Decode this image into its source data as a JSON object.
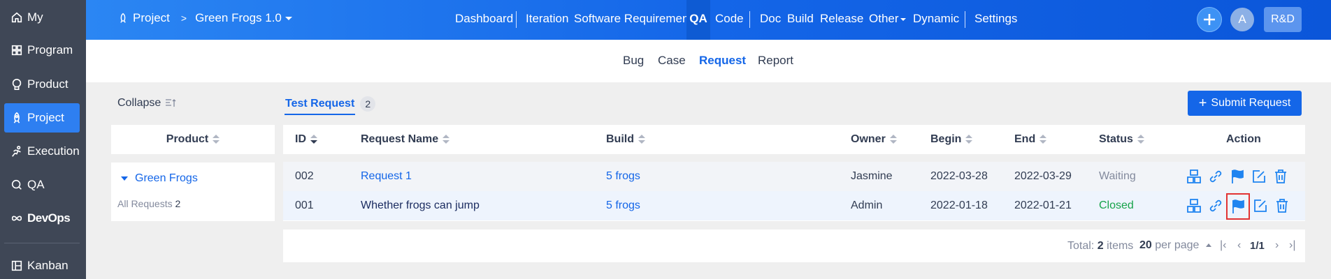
{
  "sidebar": {
    "items": [
      {
        "label": "My",
        "icon": "home-icon"
      },
      {
        "label": "Program",
        "icon": "grid-icon"
      },
      {
        "label": "Product",
        "icon": "lightbulb-icon"
      },
      {
        "label": "Project",
        "icon": "rocket-icon",
        "active": true
      },
      {
        "label": "Execution",
        "icon": "running-icon"
      },
      {
        "label": "QA",
        "icon": "magnifier-icon"
      },
      {
        "label": "DevOps",
        "icon": "infinity-icon"
      },
      {
        "label": "Kanban",
        "icon": "kanban-icon"
      }
    ]
  },
  "header": {
    "breadcrumb": {
      "root": "Project",
      "current": "Green Frogs 1.0"
    },
    "nav": [
      "Dashboard",
      "Iteration",
      "Software Requirement",
      "QA",
      "Code",
      "Doc",
      "Build",
      "Release",
      "Other",
      "Dynamic",
      "Settings"
    ],
    "active_nav": "QA",
    "avatar": "A",
    "team_button": "R&D"
  },
  "subnav": {
    "items": [
      "Bug",
      "Case",
      "Request",
      "Report"
    ],
    "active": "Request"
  },
  "left_panel": {
    "collapse_label": "Collapse",
    "column_header": "Product",
    "tree_item": "Green Frogs",
    "all_requests_label": "All Requests",
    "all_requests_count": "2"
  },
  "tabs": {
    "label": "Test Request",
    "count": "2"
  },
  "submit_button": "Submit Request",
  "table": {
    "headers": [
      "ID",
      "Request Name",
      "Build",
      "Owner",
      "Begin",
      "End",
      "Status",
      "Action"
    ],
    "rows": [
      {
        "id": "002",
        "name": "Request 1",
        "build": "5 frogs",
        "owner": "Jasmine",
        "begin": "2022-03-28",
        "end": "2022-03-29",
        "status": "Waiting"
      },
      {
        "id": "001",
        "name": "Whether frogs can jump",
        "build": "5 frogs",
        "owner": "Admin",
        "begin": "2022-01-18",
        "end": "2022-01-21",
        "status": "Closed"
      }
    ]
  },
  "pager": {
    "total_prefix": "Total:",
    "total_count": "2",
    "total_suffix": "items",
    "per_page_count": "20",
    "per_page_label": "per page",
    "page": "1/1"
  },
  "colors": {
    "accent": "#1466e8",
    "sidebar": "#3f4756",
    "status_waiting": "#838a9d",
    "status_closed": "#17a34a",
    "highlight": "#e23333"
  }
}
